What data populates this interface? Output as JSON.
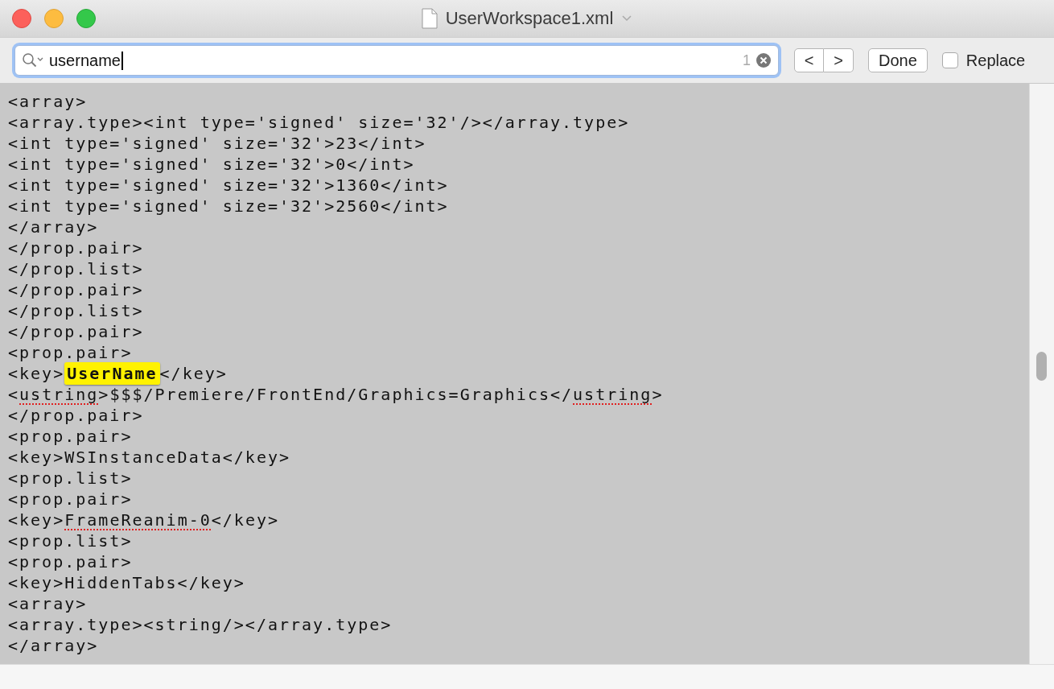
{
  "window": {
    "title": "UserWorkspace1.xml"
  },
  "find_bar": {
    "query": "username",
    "match_count": "1",
    "prev_label": "<",
    "next_label": ">",
    "done_label": "Done",
    "replace": {
      "label": "Replace",
      "checked": false
    }
  },
  "lines": [
    [
      {
        "kind": "plain",
        "text": "<array>"
      }
    ],
    [
      {
        "kind": "plain",
        "text": "<array.type><int type='signed' size='32'/></array.type>"
      }
    ],
    [
      {
        "kind": "plain",
        "text": "<int type='signed' size='32'>23</int>"
      }
    ],
    [
      {
        "kind": "plain",
        "text": "<int type='signed' size='32'>0</int>"
      }
    ],
    [
      {
        "kind": "plain",
        "text": "<int type='signed' size='32'>1360</int>"
      }
    ],
    [
      {
        "kind": "plain",
        "text": "<int type='signed' size='32'>2560</int>"
      }
    ],
    [
      {
        "kind": "plain",
        "text": "</array>"
      }
    ],
    [
      {
        "kind": "plain",
        "text": "</prop.pair>"
      }
    ],
    [
      {
        "kind": "plain",
        "text": "</prop.list>"
      }
    ],
    [
      {
        "kind": "plain",
        "text": "</prop.pair>"
      }
    ],
    [
      {
        "kind": "plain",
        "text": "</prop.list>"
      }
    ],
    [
      {
        "kind": "plain",
        "text": "</prop.pair>"
      }
    ],
    [
      {
        "kind": "plain",
        "text": "<prop.pair>"
      }
    ],
    [
      {
        "kind": "plain",
        "text": "<key>"
      },
      {
        "kind": "match",
        "text": "UserName"
      },
      {
        "kind": "plain",
        "text": "</key>"
      }
    ],
    [
      {
        "kind": "plain",
        "text": "<"
      },
      {
        "kind": "misspelled",
        "text": "ustring"
      },
      {
        "kind": "plain",
        "text": ">$$$/Premiere/FrontEnd/Graphics=Graphics</"
      },
      {
        "kind": "misspelled",
        "text": "ustring"
      },
      {
        "kind": "plain",
        "text": ">"
      }
    ],
    [
      {
        "kind": "plain",
        "text": "</prop.pair>"
      }
    ],
    [
      {
        "kind": "plain",
        "text": "<prop.pair>"
      }
    ],
    [
      {
        "kind": "plain",
        "text": "<key>WSInstanceData</key>"
      }
    ],
    [
      {
        "kind": "plain",
        "text": "<prop.list>"
      }
    ],
    [
      {
        "kind": "plain",
        "text": "<prop.pair>"
      }
    ],
    [
      {
        "kind": "plain",
        "text": "<key>"
      },
      {
        "kind": "misspelled",
        "text": "FrameReanim-0"
      },
      {
        "kind": "plain",
        "text": "</key>"
      }
    ],
    [
      {
        "kind": "plain",
        "text": "<prop.list>"
      }
    ],
    [
      {
        "kind": "plain",
        "text": "<prop.pair>"
      }
    ],
    [
      {
        "kind": "plain",
        "text": "<key>HiddenTabs</key>"
      }
    ],
    [
      {
        "kind": "plain",
        "text": "<array>"
      }
    ],
    [
      {
        "kind": "plain",
        "text": "<array.type><string/></array.type>"
      }
    ],
    [
      {
        "kind": "plain",
        "text": "</array>"
      }
    ]
  ]
}
